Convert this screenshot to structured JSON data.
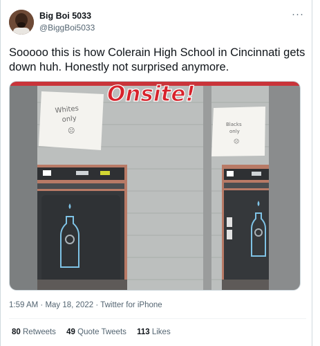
{
  "author": {
    "display_name": "Big Boi 5033",
    "handle": "@BiggBoi5033"
  },
  "more_icon": "more-horizontal-icon",
  "tweet": {
    "text": "Sooooo this is how Colerain High School in Cincinnati gets down huh. Honestly not surprised anymore."
  },
  "media": {
    "logo_text": "Onsite!",
    "sign_left": "Whites only",
    "sign_left_face": "☹",
    "sign_right": "Blacks only",
    "sign_right_face": "☹",
    "colors": {
      "wall": "#b9bcbb",
      "logo_red": "#d7232c",
      "fountain_frame": "#b67560",
      "fountain_body": "#3a3d40",
      "bottle_outline": "#7fc3e6"
    }
  },
  "meta": {
    "time": "1:59 AM",
    "date": "May 18, 2022",
    "separator": "·",
    "source": "Twitter for iPhone"
  },
  "stats": {
    "retweets_count": "80",
    "retweets_label": "Retweets",
    "quotes_count": "49",
    "quotes_label": "Quote Tweets",
    "likes_count": "113",
    "likes_label": "Likes"
  }
}
